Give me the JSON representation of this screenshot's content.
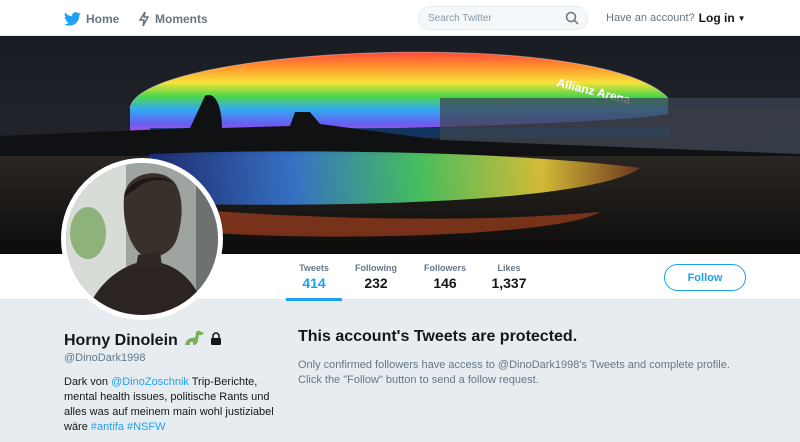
{
  "nav": {
    "home_label": "Home",
    "moments_label": "Moments",
    "search_placeholder": "Search Twitter",
    "account_prompt": "Have an account?",
    "login_label": "Log in",
    "brand_color": "#1da1f2"
  },
  "banner": {
    "stadium_sign": "Allianz Arena"
  },
  "stats": [
    {
      "label": "Tweets",
      "value": "414",
      "active": true
    },
    {
      "label": "Following",
      "value": "232"
    },
    {
      "label": "Followers",
      "value": "146"
    },
    {
      "label": "Likes",
      "value": "1,337"
    }
  ],
  "follow_button": "Follow",
  "profile": {
    "name": "Horny Dinolein",
    "handle": "@DinoDark1998",
    "bio_part1": "Dark von ",
    "bio_mention": "@DinoZoschnik",
    "bio_part2": " Trip-Berichte, mental health issues, politische Rants und alles was auf meinem main wohl justiziabel wäre ",
    "bio_hashtag1": "#antifa",
    "bio_space": " ",
    "bio_hashtag2": "#NSFW"
  },
  "protected": {
    "title": "This account's Tweets are protected.",
    "text": "Only confirmed followers have access to @DinoDark1998's Tweets and complete profile. Click the \"Follow\" button to send a follow request."
  }
}
